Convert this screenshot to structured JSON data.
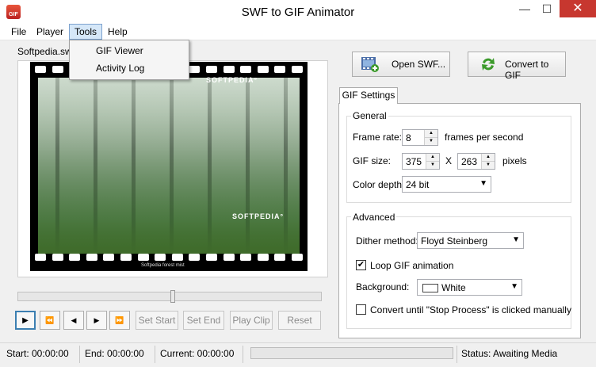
{
  "window": {
    "title": "SWF to GIF Animator",
    "app_icon_text": "GIF",
    "minimize": "—",
    "maximize": "☐",
    "close": "✕"
  },
  "menu": {
    "file": "File",
    "player": "Player",
    "tools": "Tools",
    "help": "Help"
  },
  "tools_menu": {
    "items": [
      {
        "label": "GIF Viewer"
      },
      {
        "label": "Activity Log"
      }
    ]
  },
  "player": {
    "file_name": "Softpedia.swf",
    "watermark_top": "SOFTPEDIA°",
    "watermark_mid": "SOFTPEDIA°",
    "caption": "Softpedia forest mist",
    "seek_position": 0.51
  },
  "controls": {
    "play_icon": "▶",
    "rewind_icon": "⏪",
    "prev_icon": "◀",
    "next_icon": "▶",
    "forward_icon": "⏩",
    "set_start": "Set Start",
    "set_end": "Set End",
    "play_clip": "Play Clip",
    "reset": "Reset"
  },
  "actions": {
    "open_swf": "Open SWF...",
    "convert": "Convert to GIF"
  },
  "settings": {
    "tab": "GIF Settings",
    "general": {
      "title": "General",
      "frame_rate_label": "Frame rate:",
      "frame_rate": "8",
      "frame_rate_unit": "frames per second",
      "gif_size_label": "GIF size:",
      "width": "375",
      "x": "X",
      "height": "263",
      "size_unit": "pixels",
      "color_depth_label": "Color depth:",
      "color_depth": "24 bit"
    },
    "advanced": {
      "title": "Advanced",
      "dither_label": "Dither method:",
      "dither": "Floyd Steinberg",
      "loop_label": "Loop GIF animation",
      "loop_checked": true,
      "background_label": "Background:",
      "background": "White",
      "convert_until_label": "Convert until \"Stop Process\" is clicked manually",
      "convert_until_checked": false
    }
  },
  "status": {
    "start": "Start: 00:00:00",
    "end": "End: 00:00:00",
    "current": "Current: 00:00:00",
    "status": "Status: Awaiting Media"
  },
  "colors": {
    "accent": "#3c7fb1",
    "close_button": "#c7372f",
    "menu_highlight": "#d5e7f8"
  }
}
